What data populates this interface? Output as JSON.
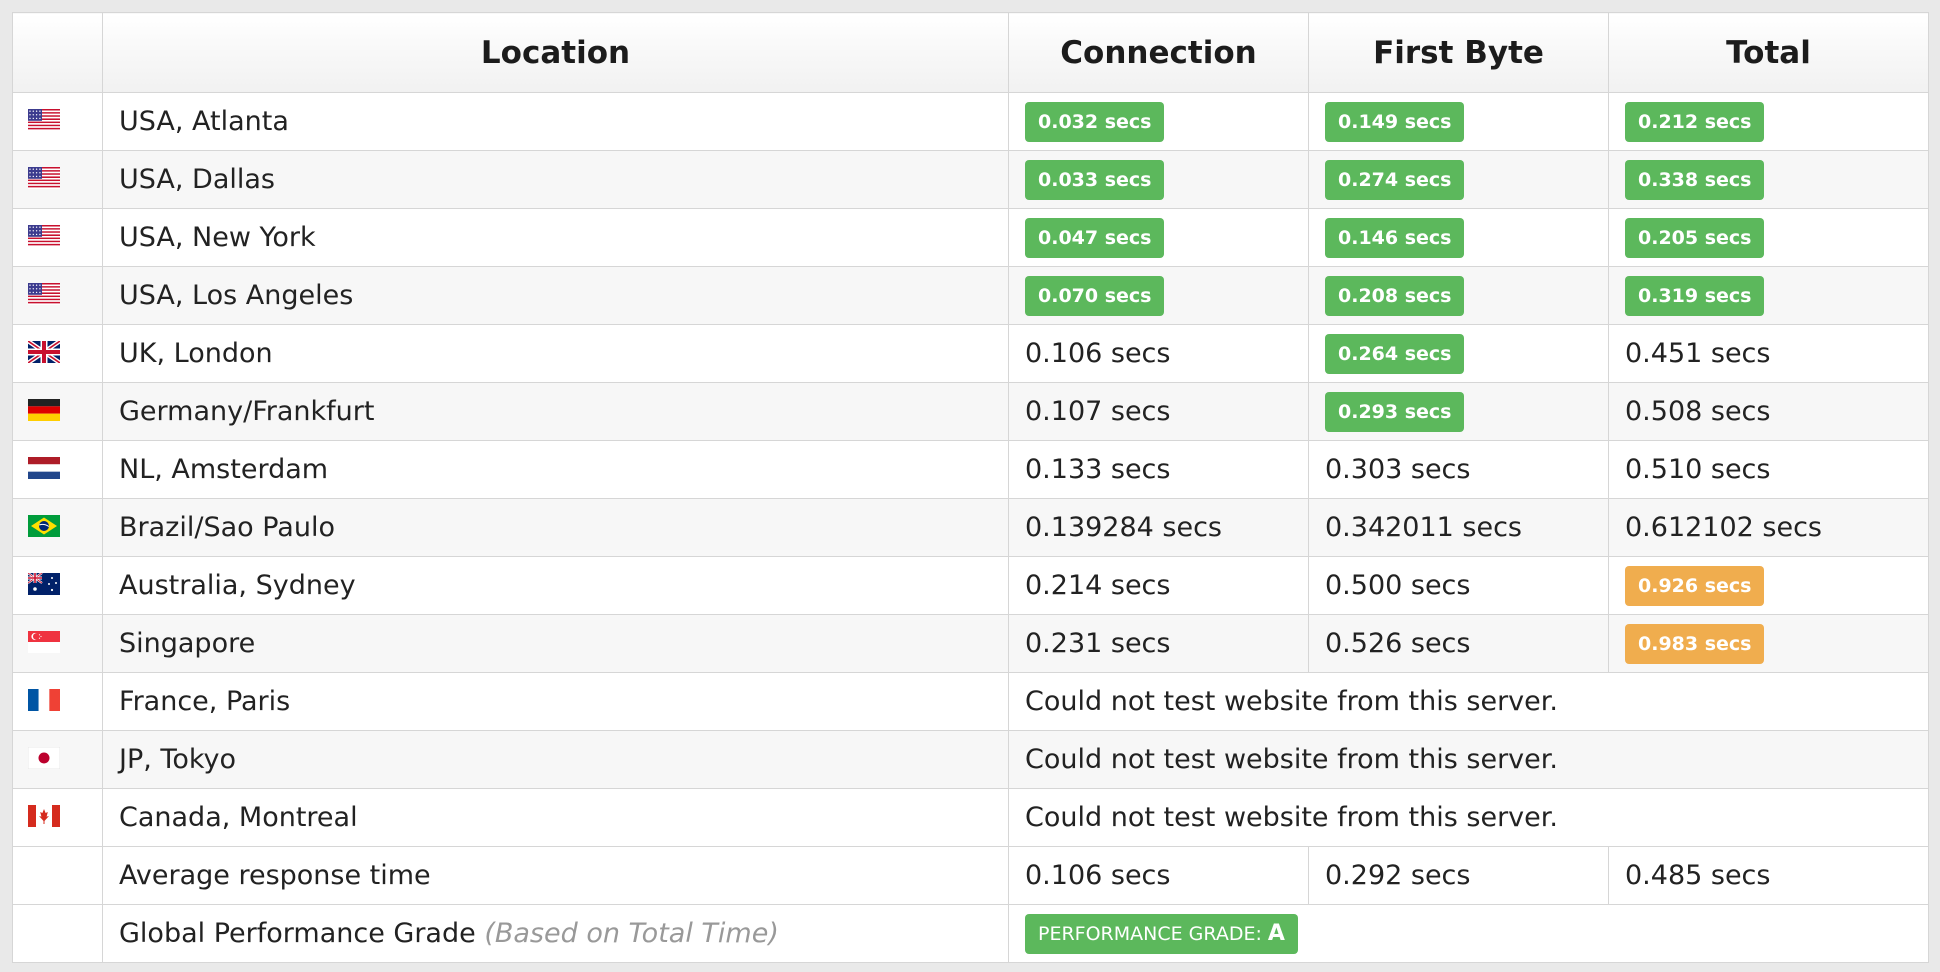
{
  "table": {
    "headers": {
      "location": "Location",
      "connection": "Connection",
      "first_byte": "First Byte",
      "total": "Total"
    },
    "rows": [
      {
        "flag": "flag-usa-icon",
        "location": "USA, Atlanta",
        "connection": {
          "text": "0.032 secs",
          "status": "green"
        },
        "first_byte": {
          "text": "0.149 secs",
          "status": "green"
        },
        "total": {
          "text": "0.212 secs",
          "status": "green"
        }
      },
      {
        "flag": "flag-usa-icon",
        "location": "USA, Dallas",
        "connection": {
          "text": "0.033 secs",
          "status": "green"
        },
        "first_byte": {
          "text": "0.274 secs",
          "status": "green"
        },
        "total": {
          "text": "0.338 secs",
          "status": "green"
        }
      },
      {
        "flag": "flag-usa-icon",
        "location": "USA, New York",
        "connection": {
          "text": "0.047 secs",
          "status": "green"
        },
        "first_byte": {
          "text": "0.146 secs",
          "status": "green"
        },
        "total": {
          "text": "0.205 secs",
          "status": "green"
        }
      },
      {
        "flag": "flag-usa-icon",
        "location": "USA, Los Angeles",
        "connection": {
          "text": "0.070 secs",
          "status": "green"
        },
        "first_byte": {
          "text": "0.208 secs",
          "status": "green"
        },
        "total": {
          "text": "0.319 secs",
          "status": "green"
        }
      },
      {
        "flag": "flag-uk-icon",
        "location": "UK, London",
        "connection": {
          "text": "0.106 secs",
          "status": "plain"
        },
        "first_byte": {
          "text": "0.264 secs",
          "status": "green"
        },
        "total": {
          "text": "0.451 secs",
          "status": "plain"
        }
      },
      {
        "flag": "flag-germany-icon",
        "location": "Germany/Frankfurt",
        "connection": {
          "text": "0.107 secs",
          "status": "plain"
        },
        "first_byte": {
          "text": "0.293 secs",
          "status": "green"
        },
        "total": {
          "text": "0.508 secs",
          "status": "plain"
        }
      },
      {
        "flag": "flag-netherlands-icon",
        "location": "NL, Amsterdam",
        "connection": {
          "text": "0.133 secs",
          "status": "plain"
        },
        "first_byte": {
          "text": "0.303 secs",
          "status": "plain"
        },
        "total": {
          "text": "0.510 secs",
          "status": "plain"
        }
      },
      {
        "flag": "flag-brazil-icon",
        "location": "Brazil/Sao Paulo",
        "connection": {
          "text": "0.139284 secs",
          "status": "plain"
        },
        "first_byte": {
          "text": "0.342011 secs",
          "status": "plain"
        },
        "total": {
          "text": "0.612102 secs",
          "status": "plain"
        }
      },
      {
        "flag": "flag-australia-icon",
        "location": "Australia, Sydney",
        "connection": {
          "text": "0.214 secs",
          "status": "plain"
        },
        "first_byte": {
          "text": "0.500 secs",
          "status": "plain"
        },
        "total": {
          "text": "0.926 secs",
          "status": "orange"
        }
      },
      {
        "flag": "flag-singapore-icon",
        "location": "Singapore",
        "connection": {
          "text": "0.231 secs",
          "status": "plain"
        },
        "first_byte": {
          "text": "0.526 secs",
          "status": "plain"
        },
        "total": {
          "text": "0.983 secs",
          "status": "orange"
        }
      },
      {
        "flag": "flag-france-icon",
        "location": "France, Paris",
        "error": "Could not test website from this server."
      },
      {
        "flag": "flag-japan-icon",
        "location": "JP, Tokyo",
        "error": "Could not test website from this server."
      },
      {
        "flag": "flag-canada-icon",
        "location": "Canada, Montreal",
        "error": "Could not test website from this server."
      }
    ],
    "average": {
      "label": "Average response time",
      "connection": "0.106 secs",
      "first_byte": "0.292 secs",
      "total": "0.485 secs"
    },
    "grade": {
      "label": "Global Performance Grade",
      "note": "(Based on Total Time)",
      "badge_label": "PERFORMANCE GRADE:",
      "letter": "A"
    }
  },
  "colors": {
    "green": "#5cb85c",
    "orange": "#f0ad4e",
    "border": "#d6d6d6",
    "stripe": "#f7f7f7",
    "page_bg": "#e9e9e9"
  }
}
